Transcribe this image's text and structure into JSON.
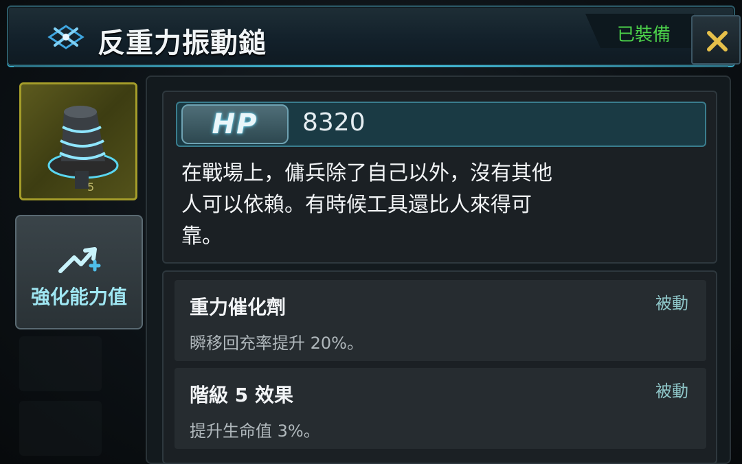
{
  "header": {
    "title": "反重力振動鎚",
    "status": "已裝備",
    "close_icon": "close-x-icon"
  },
  "item": {
    "icon": "gravity-hammer-icon",
    "level": "5",
    "frame_color": "#a59d2a"
  },
  "sidebar": {
    "upgrade_label": "強化能力值",
    "upgrade_icon": "upgrade-arrow-plus-icon"
  },
  "stat": {
    "badge": "HP",
    "value": "8320"
  },
  "description": [
    "在戰場上，傭兵除了自己以外，沒有其他",
    "人可以依賴。有時候工具還比人來得可",
    "靠。"
  ],
  "effects": [
    {
      "title": "重力催化劑",
      "type": "被動",
      "desc": "瞬移回充率提升 20%。"
    },
    {
      "title": "階級 5 效果",
      "type": "被動",
      "desc": "提升生命值 3%。"
    }
  ],
  "colors": {
    "accent": "#46c6e4",
    "equipped": "#4cd24a",
    "close": "#e6c04a"
  }
}
